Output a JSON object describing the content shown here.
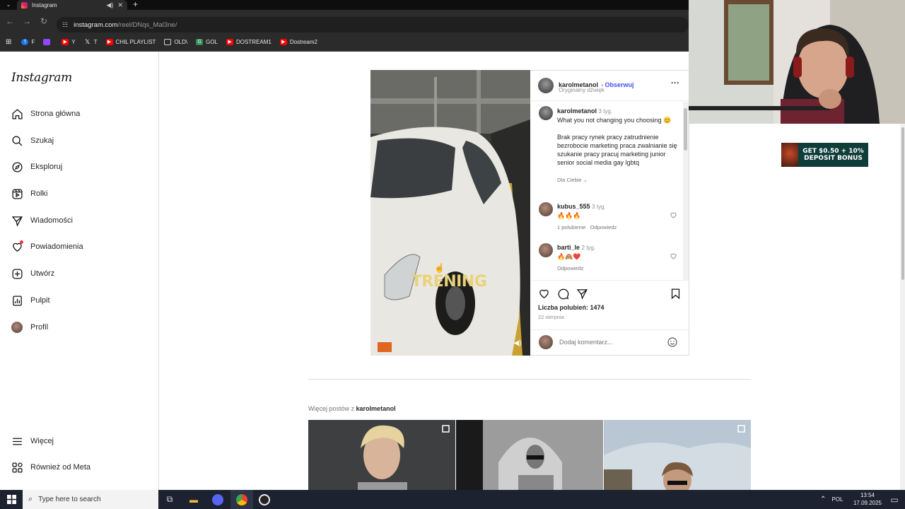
{
  "browser": {
    "tab_title": "Instagram",
    "tab_audio_icon": "speaker-icon",
    "url_domain": "instagram.com",
    "url_path": "/reel/DNqs_Mal3ne/",
    "bookmarks": [
      {
        "label": "F",
        "icon": "facebook-icon",
        "color": "#1877f2"
      },
      {
        "label": "",
        "icon": "twitch-icon",
        "color": "#9146ff"
      },
      {
        "label": "Y",
        "icon": "youtube-icon",
        "color": "#ff0000"
      },
      {
        "label": "T",
        "icon": "x-icon",
        "color": "#000000"
      },
      {
        "label": "CHIL PLAYLIST",
        "icon": "youtube-icon",
        "color": "#ff0000"
      },
      {
        "label": "OLD\\",
        "icon": "folder-icon",
        "color": "#2b2b2b"
      },
      {
        "label": "GOL",
        "icon": "gol-icon",
        "color": "#2e8b57"
      },
      {
        "label": "DOSTREAM1",
        "icon": "youtube-icon",
        "color": "#ff0000"
      },
      {
        "label": "Dostream2",
        "icon": "youtube-icon",
        "color": "#ff0000"
      }
    ]
  },
  "sidebar": {
    "logo": "Instagram",
    "items": [
      {
        "label": "Strona główna",
        "icon": "home-icon"
      },
      {
        "label": "Szukaj",
        "icon": "search-icon"
      },
      {
        "label": "Eksploruj",
        "icon": "compass-icon"
      },
      {
        "label": "Rolki",
        "icon": "reels-icon"
      },
      {
        "label": "Wiadomości",
        "icon": "send-icon"
      },
      {
        "label": "Powiadomienia",
        "icon": "heart-icon"
      },
      {
        "label": "Utwórz",
        "icon": "plus-icon"
      },
      {
        "label": "Pulpit",
        "icon": "chart-icon"
      },
      {
        "label": "Profil",
        "icon": "avatar-icon"
      }
    ],
    "bottom_items": [
      {
        "label": "Więcej",
        "icon": "menu-icon"
      },
      {
        "label": "Również od Meta",
        "icon": "meta-icon"
      }
    ]
  },
  "post": {
    "author": "karolmetanol",
    "follow_label": "Obserwuj",
    "audio": "Oryginalny dźwięk",
    "video_overlay_text": "TRENING",
    "caption": {
      "author": "karolmetanol",
      "time": "3 tyg.",
      "text": "What you not changing you choosing 😊",
      "tags": "Brak pracy rynek pracy zatrudnienie bezrobocie marketing praca zwalnianie się szukanie pracy pracuj marketing junior senior social media gay lgbtq",
      "translation": "Dla Ciebie"
    },
    "comments": [
      {
        "author": "kubus_555",
        "time": "3 tyg.",
        "text": "🔥🔥🔥",
        "likes": "1 polubienie",
        "reply": "Odpowiedz"
      },
      {
        "author": "barti_le",
        "time": "2 tyg.",
        "text": "🔥🙈❤️",
        "likes": "",
        "reply": "Odpowiedz"
      }
    ],
    "likes_label": "Liczba polubień: 1474",
    "date": "22 sierpnia",
    "comment_placeholder": "Dodaj komentarz..."
  },
  "more_posts": {
    "prefix": "Więcej postów z",
    "author": "karolmetanol"
  },
  "ad": {
    "text_line1": "GET $0.50 + 10%",
    "text_line2": "DEPOSIT BONUS"
  },
  "taskbar": {
    "search_placeholder": "Type here to search",
    "language": "POL",
    "time": "13:54",
    "date": "17.09.2025"
  },
  "colors": {
    "follow_blue": "#4150f7",
    "browser_dark": "#2b2b2b",
    "overlay_text": "#e9d27a"
  }
}
